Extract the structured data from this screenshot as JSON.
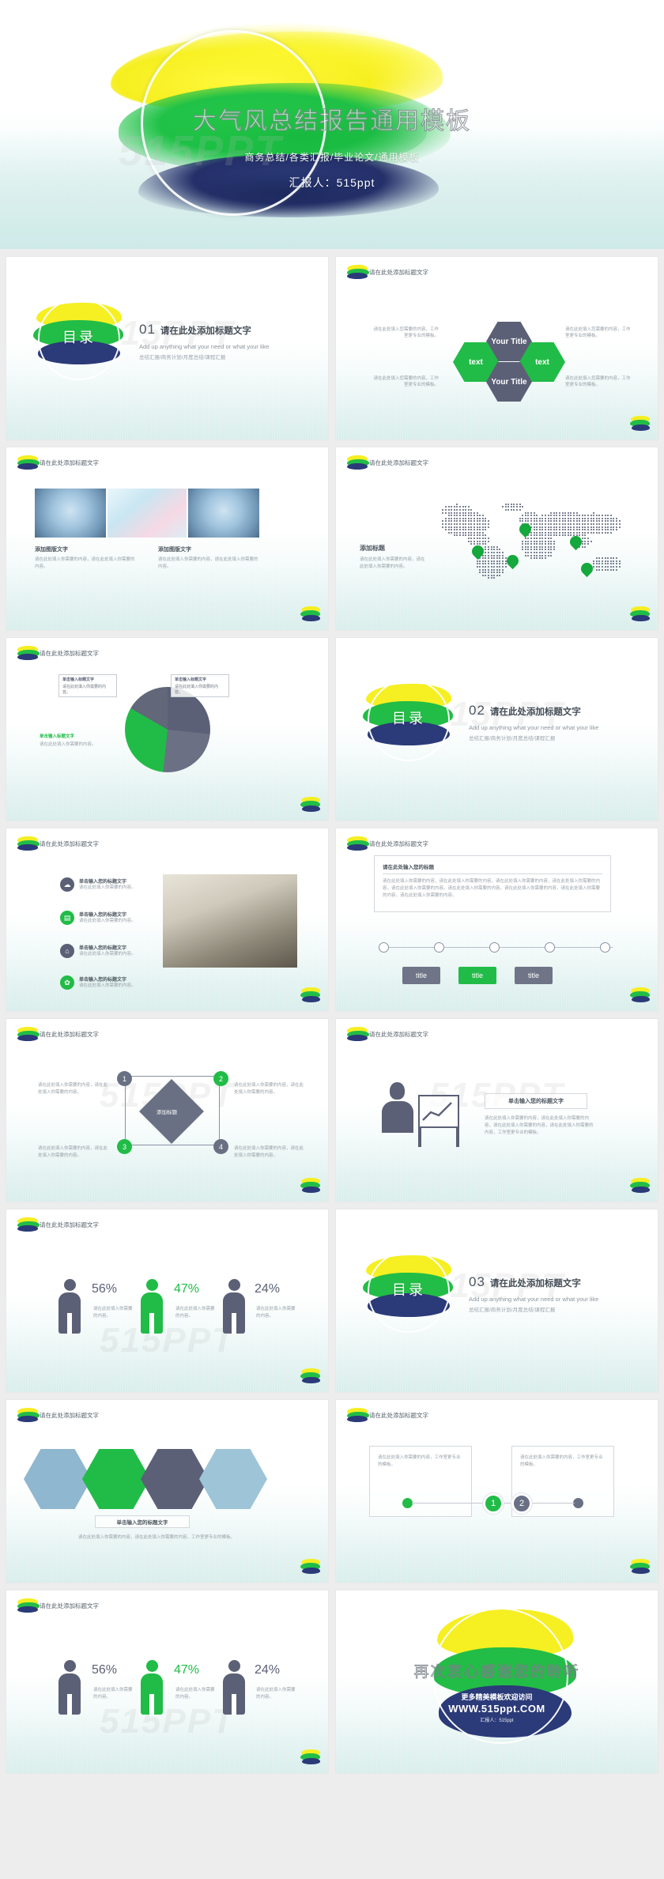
{
  "hero": {
    "title": "大气风总结报告通用模板",
    "subtitle": "商务总结/各类汇报/毕业论文/通用模板",
    "presenter": "汇报人：515ppt",
    "watermark": "515PPT"
  },
  "common": {
    "header_title": "请在此处添加标题文字",
    "watermark": "515PPT",
    "body_text": "请在此处填入你需要的内容，工作室更专业的模板。",
    "body_text_short": "请在此处填入你需要的内容。",
    "click_title": "单击输入您的标题文字",
    "add_title": "添加标题",
    "add_title_text": "添加标题文字"
  },
  "slides": [
    {
      "id": "toc-01",
      "type": "toc",
      "badge": "目录",
      "number": "01",
      "heading": "请在此处添加标题文字",
      "english": "Add up anything what your need or what your like",
      "chinese": "总结汇报/商务计划/月度总结/课程汇报"
    },
    {
      "id": "hexagon",
      "type": "hexagon",
      "header": "请在此处添加标题文字",
      "hexes": [
        {
          "label": "Your Title",
          "color": "navy"
        },
        {
          "label": "text",
          "color": "green"
        },
        {
          "label": "text",
          "color": "green"
        },
        {
          "label": "Your Title",
          "color": "navy"
        }
      ],
      "notes": [
        "请在此处填入您需要的内容，工作室更专业的模板。",
        "请在此处填入您需要的内容，工作室更专业的模板。",
        "请在此处填入您需要的内容，工作室更专业的模板。",
        "请在此处填入您需要的内容，工作室更专业的模板。"
      ]
    },
    {
      "id": "photos",
      "type": "photos",
      "header": "请在此处添加标题文字",
      "captions": [
        {
          "title": "添加图版文字",
          "body": "请在此处填入你需要的内容，请在此处填入你需要的内容。"
        },
        {
          "title": "添加图版文字",
          "body": "请在此处填入你需要的内容，请在此处填入你需要的内容。"
        }
      ]
    },
    {
      "id": "worldmap",
      "type": "map",
      "header": "请在此处添加标题文字",
      "caption_title": "添加标题",
      "caption_body": "请在此处填入你需要的内容，请在此处填入你需要的内容。"
    },
    {
      "id": "piechart",
      "type": "pie",
      "header": "请在此处添加标题文字",
      "callouts": [
        "单击输入标题文字",
        "单击输入标题文字",
        "单击输入标题文字"
      ],
      "callout_green": "单击输入标题文字",
      "callout_body": "请在此处填入你需要的内容。"
    },
    {
      "id": "toc-02",
      "type": "toc",
      "badge": "目录",
      "number": "02",
      "heading": "请在此处添加标题文字",
      "english": "Add up anything what your need or what your like",
      "chinese": "总结汇报/商务计划/月度总结/课程汇报"
    },
    {
      "id": "iconlist",
      "type": "iconlist",
      "header": "请在此处添加标题文字",
      "items": [
        {
          "icon": "cloud-icon",
          "title": "单击输入您的标题文字",
          "body": "请在此处填入你需要的内容。",
          "color": "navy"
        },
        {
          "icon": "database-icon",
          "title": "单击输入您的标题文字",
          "body": "请在此处填入你需要的内容。",
          "color": "green"
        },
        {
          "icon": "home-icon",
          "title": "单击输入您的标题文字",
          "body": "请在此处填入你需要的内容。",
          "color": "navy"
        },
        {
          "icon": "gear-icon",
          "title": "单击输入您的标题文字",
          "body": "请在此处填入你需要的内容。",
          "color": "green"
        }
      ]
    },
    {
      "id": "timeline",
      "type": "timeline",
      "header": "请在此处添加标题文字",
      "box_title": "请在此处输入您的标题",
      "box_body": "请在此处填入你需要的内容，请在此处填入你需要的内容，请在此处填入你需要的内容，请在此处填入你需要的内容，请在此处填入你需要的内容。请在此处填入你需要的内容。请在此处填入你需要的内容，请在此处填入你需要的内容，请在此处填入你需要的内容。",
      "chips": [
        {
          "label": "title",
          "color": "navy"
        },
        {
          "label": "title",
          "color": "green"
        },
        {
          "label": "title",
          "color": "navy"
        }
      ]
    },
    {
      "id": "diamond",
      "type": "diamond",
      "header": "请在此处添加标题文字",
      "center_label": "添加标题",
      "nodes": [
        {
          "num": "1",
          "color": "navy",
          "body": "请在此处填入你需要的内容，请在此处填入你需要的内容。"
        },
        {
          "num": "2",
          "color": "green",
          "body": "请在此处填入你需要的内容，请在此处填入你需要的内容。"
        },
        {
          "num": "3",
          "color": "green",
          "body": "请在此处填入你需要的内容，请在此处填入你需要的内容。"
        },
        {
          "num": "4",
          "color": "navy",
          "body": "请在此处填入你需要的内容，请在此处填入你需要的内容。"
        }
      ]
    },
    {
      "id": "businessman",
      "type": "businessman",
      "header": "请在此处添加标题文字",
      "box_title": "单击输入您的标题文字",
      "box_body": "请在此处填入你需要的内容，请在此处填入你需要的内容，请在此处填入你需要的内容，请在此处填入你需要的内容，工作室更专业的模板。"
    },
    {
      "id": "people-1",
      "type": "people",
      "header": "请在此处添加标题文字",
      "people": [
        {
          "pct": "56%",
          "color": "navy",
          "body": "请在此处填入你需要的内容。"
        },
        {
          "pct": "47%",
          "color": "green",
          "body": "请在此处填入你需要的内容。"
        },
        {
          "pct": "24%",
          "color": "navy",
          "body": "请在此处填入你需要的内容。"
        }
      ]
    },
    {
      "id": "toc-03",
      "type": "toc",
      "badge": "目录",
      "number": "03",
      "heading": "请在此处添加标题文字",
      "english": "Add up anything what your need or what your like",
      "chinese": "总结汇报/商务计划/月度总结/课程汇报"
    },
    {
      "id": "hex-photo",
      "type": "hexphoto",
      "header": "请在此处添加标题文字",
      "box_title": "单击输入您的标题文字",
      "box_body": "请在此处填入你需要的内容，请在此处填入你需要的内容，工作室更专业的模板。"
    },
    {
      "id": "two-cards",
      "type": "twocards",
      "header": "请在此处添加标题文字",
      "cards": [
        {
          "body": "请在此处填入你需要的内容，工作室更专业的模板。"
        },
        {
          "body": "请在此处填入你需要的内容，工作室更专业的模板。"
        }
      ],
      "numbers": [
        {
          "label": "1",
          "color": "green"
        },
        {
          "label": "2",
          "color": "navy"
        }
      ]
    },
    {
      "id": "people-2",
      "type": "people",
      "header": "请在此处添加标题文字",
      "people": [
        {
          "pct": "56%",
          "color": "navy",
          "body": "请在此处填入你需要的内容。"
        },
        {
          "pct": "47%",
          "color": "green",
          "body": "请在此处填入你需要的内容。"
        },
        {
          "pct": "24%",
          "color": "navy",
          "body": "请在此处填入你需要的内容。"
        }
      ]
    },
    {
      "id": "thanks",
      "type": "thanks",
      "title": "再次衷心感谢您的聆听",
      "line1": "更多精美模板欢迎访问",
      "line2": "WWW.515ppt.COM",
      "line3": "汇报人：515ppt"
    }
  ],
  "colors": {
    "yellow": "#f6ef22",
    "green": "#21bc47",
    "navy": "#2b3a78",
    "gray": "#5b6076"
  }
}
